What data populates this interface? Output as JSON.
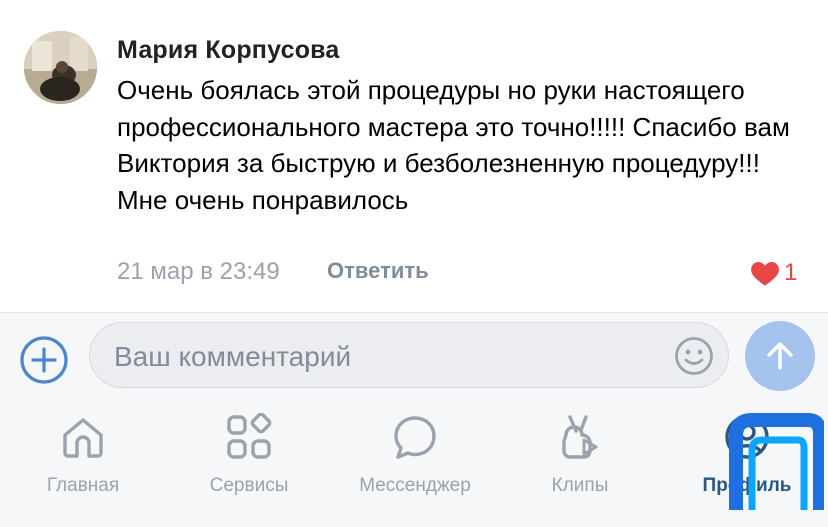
{
  "comment": {
    "author": "Мария Корпусова",
    "text": "Очень боялась этой процедуры но руки настоящего профессионального мастера это точно!!!!! Спасибо вам Виктория за быструю и безболезненную процедуру!!! Мне очень понравилось",
    "date": "21 мар в 23:49",
    "reply_label": "Ответить",
    "likes": "1",
    "like_color": "#e64646"
  },
  "composer": {
    "placeholder": "Ваш комментарий",
    "accent": "#4986cc",
    "send_color": "#a4c3ef"
  },
  "tabbar": {
    "active_color": "#2a5885",
    "inactive_color": "#99a2ad",
    "tabs": [
      {
        "label": "Главная",
        "icon": "home-icon"
      },
      {
        "label": "Сервисы",
        "icon": "services-icon"
      },
      {
        "label": "Мессенджер",
        "icon": "messenger-icon"
      },
      {
        "label": "Клипы",
        "icon": "clips-icon"
      },
      {
        "label": "Профиль",
        "icon": "profile-icon",
        "active": true
      }
    ]
  }
}
